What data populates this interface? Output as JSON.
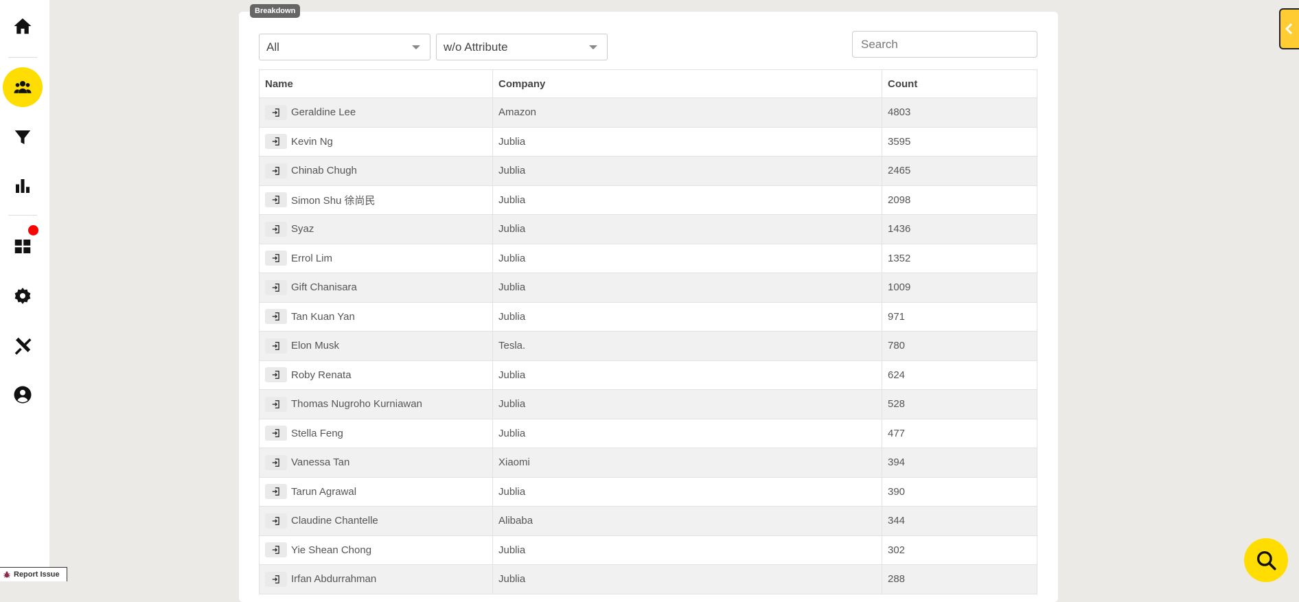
{
  "sidebar": {
    "items": [
      {
        "icon": "home-icon"
      },
      {
        "icon": "users-icon",
        "active": true
      },
      {
        "icon": "filter-icon"
      },
      {
        "icon": "bar-chart-icon"
      },
      {
        "icon": "dashboard-icon",
        "has_notification": true
      },
      {
        "icon": "gear-icon"
      },
      {
        "icon": "tools-icon"
      },
      {
        "icon": "account-icon"
      }
    ],
    "report_issue_label": "Report Issue"
  },
  "panel": {
    "tag_label": "Breakdown",
    "filter_select_value": "All",
    "attribute_select_value": "w/o Attribute",
    "search_placeholder": "Search"
  },
  "table": {
    "columns": [
      "Name",
      "Company",
      "Count"
    ],
    "rows": [
      {
        "name": "Geraldine Lee",
        "company": "Amazon",
        "count": "4803"
      },
      {
        "name": "Kevin Ng",
        "company": "Jublia",
        "count": "3595"
      },
      {
        "name": "Chinab Chugh",
        "company": "Jublia",
        "count": "2465"
      },
      {
        "name": "Simon Shu 徐尚民",
        "company": "Jublia",
        "count": "2098"
      },
      {
        "name": "Syaz",
        "company": "Jublia",
        "count": "1436"
      },
      {
        "name": "Errol Lim",
        "company": "Jublia",
        "count": "1352"
      },
      {
        "name": "Gift Chanisara",
        "company": "Jublia",
        "count": "1009"
      },
      {
        "name": "Tan Kuan Yan",
        "company": "Jublia",
        "count": "971"
      },
      {
        "name": "Elon Musk",
        "company": "Tesla.",
        "count": "780"
      },
      {
        "name": "Roby Renata",
        "company": "Jublia",
        "count": "624"
      },
      {
        "name": "Thomas Nugroho Kurniawan",
        "company": "Jublia",
        "count": "528"
      },
      {
        "name": "Stella Feng",
        "company": "Jublia",
        "count": "477"
      },
      {
        "name": "Vanessa Tan",
        "company": "Xiaomi",
        "count": "394"
      },
      {
        "name": "Tarun Agrawal",
        "company": "Jublia",
        "count": "390"
      },
      {
        "name": "Claudine Chantelle",
        "company": "Alibaba",
        "count": "344"
      },
      {
        "name": "Yie Shean Chong",
        "company": "Jublia",
        "count": "302"
      },
      {
        "name": "Irfan Abdurrahman",
        "company": "Jublia",
        "count": "288"
      }
    ]
  },
  "colors": {
    "accent": "#ffdd00",
    "side_tab": "#ffcc33",
    "notification": "#ff0000",
    "page_bg": "#eceae6"
  }
}
